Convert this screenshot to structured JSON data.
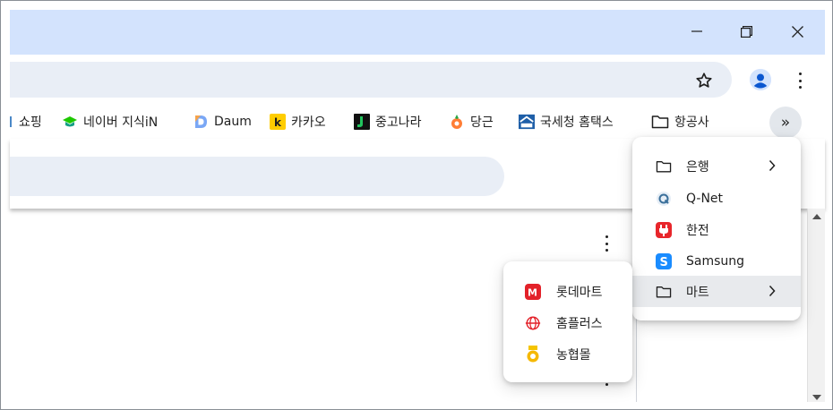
{
  "window_controls": {
    "minimize_icon": "minimize-icon",
    "maximize_icon": "restore-icon",
    "close_icon": "close-icon"
  },
  "toolbar": {
    "star_icon": "star-icon",
    "profile_icon": "profile-icon",
    "menu_icon": "more-vert-icon"
  },
  "bookmarks": {
    "items": [
      {
        "label": "쇼핑",
        "icon": "shopping-icon"
      },
      {
        "label": "네이버 지식iN",
        "icon": "naver-kin-icon"
      },
      {
        "label": "Daum",
        "icon": "daum-icon"
      },
      {
        "label": "카카오",
        "icon": "kakao-icon"
      },
      {
        "label": "중고나라",
        "icon": "joonggonara-icon"
      },
      {
        "label": "당근",
        "icon": "carrot-icon"
      },
      {
        "label": "국세청 홈택스",
        "icon": "hometax-icon"
      },
      {
        "label": "항공사",
        "icon": "folder-icon"
      }
    ],
    "overflow_label": "»"
  },
  "overflow_menu": {
    "items": [
      {
        "label": "은행",
        "icon": "folder-icon",
        "has_submenu": true
      },
      {
        "label": "Q-Net",
        "icon": "qnet-icon",
        "has_submenu": false
      },
      {
        "label": "한전",
        "icon": "kepco-icon",
        "has_submenu": false
      },
      {
        "label": "Samsung",
        "icon": "samsung-icon",
        "has_submenu": false
      },
      {
        "label": "마트",
        "icon": "folder-icon",
        "has_submenu": true
      }
    ]
  },
  "mart_submenu": {
    "items": [
      {
        "label": "롯데마트",
        "icon": "lottemart-icon"
      },
      {
        "label": "홈플러스",
        "icon": "homeplus-icon"
      },
      {
        "label": "농협몰",
        "icon": "nhmall-icon"
      }
    ]
  },
  "colors": {
    "titlebar": "#d3e3fd",
    "omnibox": "#e9eef6",
    "text": "#1f1f1f",
    "hover": "#e8eaed"
  }
}
